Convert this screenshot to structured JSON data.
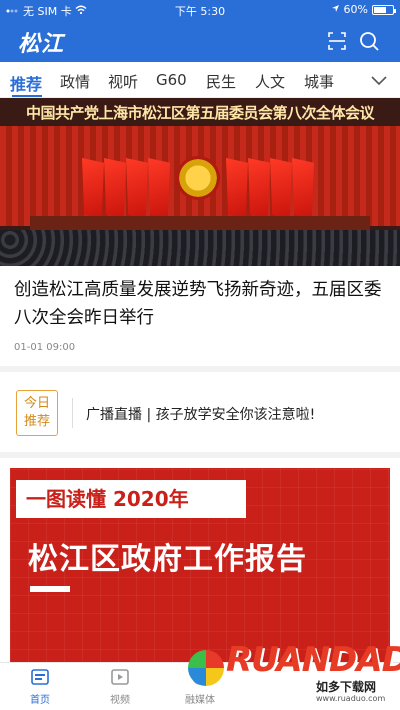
{
  "status_bar": {
    "carrier": "无 SIM 卡",
    "time": "下午 5:30",
    "battery": "60%"
  },
  "header": {
    "logo": "松江",
    "icons": [
      "scan-icon",
      "search-icon"
    ]
  },
  "tabs": [
    {
      "label": "推荐",
      "active": true
    },
    {
      "label": "政情"
    },
    {
      "label": "视听"
    },
    {
      "label": "G60"
    },
    {
      "label": "民生"
    },
    {
      "label": "人文"
    },
    {
      "label": "城事"
    }
  ],
  "banner": {
    "title": "中国共产党上海市松江区第五届委员会第八次全体会议"
  },
  "article": {
    "headline": "创造松江高质量发展逆势飞扬新奇迹，五届区委八次全会昨日举行",
    "date": "01-01 09:00"
  },
  "recommend": {
    "badge_line1": "今日",
    "badge_line2": "推荐",
    "text": "广播直播 | 孩子放学安全你该注意啦!"
  },
  "poster": {
    "subtitle": "一图读懂 2020年",
    "title": "松江区政府工作报告"
  },
  "watermark": {
    "brand": "RUANDADO",
    "cn": "如多下载网",
    "url": "www.ruaduo.com"
  },
  "bottom_nav": [
    {
      "label": "首页",
      "icon": "home-icon",
      "active": true
    },
    {
      "label": "视频",
      "icon": "video-icon"
    },
    {
      "label": "融媒体",
      "icon": "media-icon"
    }
  ],
  "colors": {
    "brand": "#2a6ed8",
    "poster_red": "#c9201a",
    "badge_orange": "#d38a1a"
  }
}
